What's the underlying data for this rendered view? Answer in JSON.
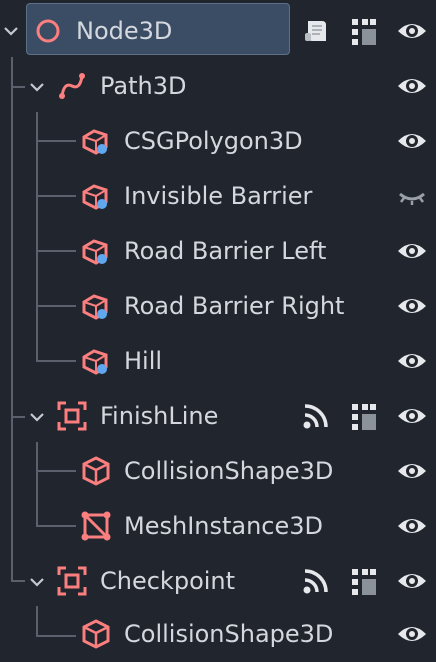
{
  "tree": {
    "nodes": [
      {
        "label": "Node3D",
        "type": "node3d",
        "selected": true
      },
      {
        "label": "Path3D",
        "type": "path3d"
      },
      {
        "label": "CSGPolygon3D",
        "type": "csgpolygon"
      },
      {
        "label": "Invisible Barrier",
        "type": "csgpolygon",
        "hidden": true
      },
      {
        "label": "Road Barrier Left",
        "type": "csgpolygon"
      },
      {
        "label": "Road Barrier Right",
        "type": "csgpolygon"
      },
      {
        "label": "Hill",
        "type": "csgpolygon"
      },
      {
        "label": "FinishLine",
        "type": "area3d"
      },
      {
        "label": "CollisionShape3D",
        "type": "collisionshape"
      },
      {
        "label": "MeshInstance3D",
        "type": "meshinstance"
      },
      {
        "label": "Checkpoint",
        "type": "area3d"
      },
      {
        "label": "CollisionShape3D",
        "type": "collisionshape"
      }
    ]
  },
  "colors": {
    "background": "#21262e",
    "selection": "#3a4d64",
    "node_icon": "#fc7f7f",
    "csg_badge": "#5fa8f0",
    "text": "#d4d8de",
    "guide_line": "#5a616c"
  },
  "icons": {
    "visibility": "eye-icon",
    "hidden": "eye-closed-icon",
    "script": "script-icon",
    "group": "group-icon",
    "signals": "signal-icon"
  }
}
